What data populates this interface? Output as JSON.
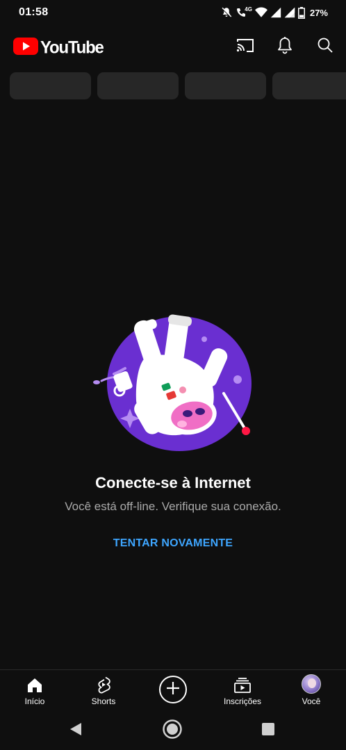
{
  "status_bar": {
    "time": "01:58",
    "network_label": "4G",
    "battery_percent": "27%"
  },
  "header": {
    "app_name": "YouTube",
    "brand_color": "#ff0000",
    "icons": [
      "cast-icon",
      "bell-icon",
      "search-icon"
    ]
  },
  "chips_loading_count": 4,
  "offline": {
    "title": "Conecte-se à Internet",
    "message": "Você está off-line. Verifique sua conexão.",
    "retry_label": "TENTAR NOVAMENTE",
    "accent_color": "#3ea6ff"
  },
  "bottom_nav": {
    "items": [
      {
        "label": "Início",
        "icon": "home-icon"
      },
      {
        "label": "Shorts",
        "icon": "shorts-icon"
      },
      {
        "label": "",
        "icon": "create-plus-icon"
      },
      {
        "label": "Inscrições",
        "icon": "subscriptions-icon"
      },
      {
        "label": "Você",
        "icon": "avatar"
      }
    ]
  },
  "system_nav": [
    "back-icon",
    "home-circle-icon",
    "recents-icon"
  ]
}
